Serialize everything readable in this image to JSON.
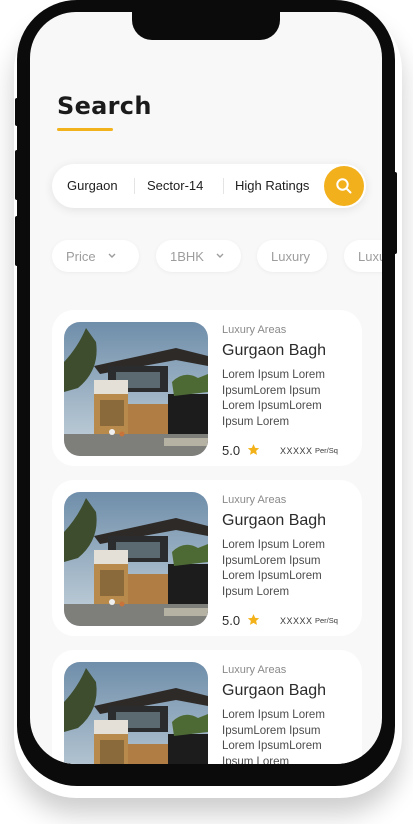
{
  "page": {
    "title": "Search"
  },
  "search": {
    "location": "Gurgaon",
    "sector": "Sector-14",
    "filter": "High Ratings"
  },
  "chips": [
    {
      "label": "Price",
      "has_dropdown": true
    },
    {
      "label": "1BHK",
      "has_dropdown": true
    },
    {
      "label": "Luxury",
      "has_dropdown": false
    },
    {
      "label": "Luxury",
      "has_dropdown": false
    }
  ],
  "listings": [
    {
      "category": "Luxury Areas",
      "title": "Gurgaon Bagh",
      "description": "Lorem Ipsum Lorem IpsumLorem Ipsum Lorem IpsumLorem Ipsum Lorem",
      "rating": "5.0",
      "price": "XXXXX",
      "unit": "Per/Sq"
    },
    {
      "category": "Luxury Areas",
      "title": "Gurgaon Bagh",
      "description": "Lorem Ipsum Lorem IpsumLorem Ipsum Lorem IpsumLorem Ipsum Lorem",
      "rating": "5.0",
      "price": "XXXXX",
      "unit": "Per/Sq"
    },
    {
      "category": "Luxury Areas",
      "title": "Gurgaon Bagh",
      "description": "Lorem Ipsum Lorem IpsumLorem Ipsum Lorem IpsumLorem Ipsum Lorem",
      "rating": "",
      "price": "",
      "unit": ""
    }
  ],
  "colors": {
    "accent": "#f2b01c",
    "background": "#f8f8f8",
    "card": "#ffffff",
    "star": "#f3b21a"
  },
  "icons": {
    "search": "search-icon",
    "dropdown": "chevron-down-icon",
    "rating": "star-icon"
  }
}
